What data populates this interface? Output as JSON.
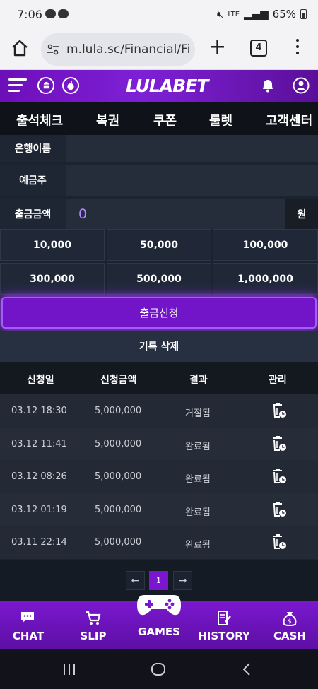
{
  "status": {
    "time": "7:06",
    "network": "LTE",
    "battery": "65%"
  },
  "browser": {
    "url": "m.lula.sc/Financial/Fi",
    "tab_count": "4"
  },
  "site": {
    "logo": "LULABET"
  },
  "nav": [
    "출석체크",
    "복권",
    "쿠폰",
    "룰렛",
    "고객센터"
  ],
  "form": {
    "bank_label": "은행이름",
    "holder_label": "예금주",
    "amount_label": "출금금액",
    "amount_value": "0",
    "unit": "원"
  },
  "amounts": [
    "10,000",
    "50,000",
    "100,000",
    "300,000",
    "500,000",
    "1,000,000"
  ],
  "buttons": {
    "apply": "출금신청",
    "delete": "기록 삭제"
  },
  "table": {
    "headers": [
      "신청일",
      "신청금액",
      "결과",
      "관리"
    ],
    "rows": [
      {
        "date": "03.12 18:30",
        "amount": "5,000,000",
        "result": "거절됨"
      },
      {
        "date": "03.12 11:41",
        "amount": "5,000,000",
        "result": "완료됨"
      },
      {
        "date": "03.12 08:26",
        "amount": "5,000,000",
        "result": "완료됨"
      },
      {
        "date": "03.12 01:19",
        "amount": "5,000,000",
        "result": "완료됨"
      },
      {
        "date": "03.11 22:14",
        "amount": "5,000,000",
        "result": "완료됨"
      }
    ]
  },
  "pager": {
    "prev": "←",
    "current": "1",
    "next": "→"
  },
  "bottom": {
    "chat": "CHAT",
    "slip": "SLIP",
    "games": "GAMES",
    "history": "HISTORY",
    "cash": "CASH"
  },
  "icons": [
    "home-icon",
    "tune-icon",
    "plus-icon",
    "tabs-icon",
    "more-icon",
    "menu-icon",
    "android-icon",
    "apple-icon",
    "bell-icon",
    "user-icon",
    "trash-clock-icon",
    "chat-icon",
    "cart-icon",
    "gamepad-icon",
    "history-icon",
    "money-bag-icon"
  ],
  "colors": {
    "accent": "#7a16d0",
    "bg": "#1c2330",
    "amount": "#b088ff"
  }
}
